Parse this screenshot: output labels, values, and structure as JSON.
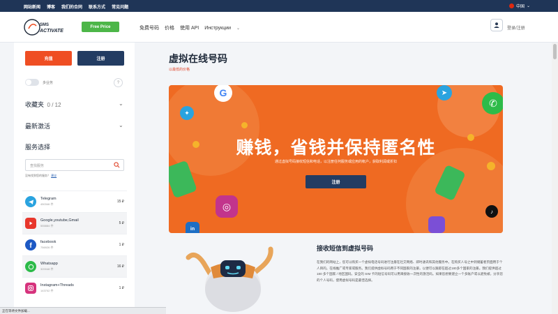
{
  "topbar": {
    "links": [
      "网站新闻",
      "博客",
      "我们的合同",
      "联系方式",
      "常见问题"
    ],
    "language": "中国"
  },
  "header": {
    "logo_text": "SMS ACTIVATE",
    "free_price": "Free Price",
    "nav": [
      "免费号码",
      "价格",
      "使用 API",
      "Инструкции"
    ],
    "login": "登录/注册"
  },
  "sidebar": {
    "btn_recharge": "充值",
    "btn_register": "注册",
    "toggle_label": "多业务",
    "help_icon": "?",
    "favorites": "收藏夹",
    "favorites_count": "0 / 12",
    "recent": "最新激活",
    "services_title": "服务选择",
    "search_placeholder": "查找服务",
    "hint_text": "没有找到您的服务？",
    "hint_link": "建议",
    "services": [
      {
        "name": "Telegram",
        "sub": "450346 件",
        "price": "15 ₽",
        "icon": "telegram-icon",
        "color": "#2aa3df"
      },
      {
        "name": "Google,youtube,Gmail",
        "sub": "555884 件",
        "price": "5 ₽",
        "icon": "google-icon",
        "color": "#e8372c"
      },
      {
        "name": "facebook",
        "sub": "756926 件",
        "price": "1 ₽",
        "icon": "facebook-icon",
        "color": "#1d59c4"
      },
      {
        "name": "Whatsapp",
        "sub": "320048 件",
        "price": "16 ₽",
        "icon": "whatsapp-icon",
        "color": "#2dbb49"
      },
      {
        "name": "Instagram+Threads",
        "sub": "143702 件",
        "price": "1 ₽",
        "icon": "instagram-icon",
        "color": "#d6337d"
      }
    ]
  },
  "main": {
    "title": "虚拟在线号码",
    "subtitle": "以最低的价格",
    "banner_title": "赚钱，省钱并保持匿名性",
    "banner_desc": "通过虚拟号码接收短信和电话，以注册任何服务或应用的帐户，获取利润或折扣",
    "banner_button": "注册",
    "section_title": "接收短信到虚拟号码",
    "section_text": "在我们的网站上，您可以购买一个虚拟电话号码进行注册在社交网络、即时通讯和其他服务中。在购买人号之中到储蓄者页面用于个人目的。在线推广或专家或服务。我们提供虚拟号码用于不同国家的注册，以便可以跟踪在超过180多个国家的注册。我们提供超过 180 多个国家 / 地区国码。安全的 SIM 卡的短信号码可以用来接收一次性的激活码。如果您想要建立一个多账户或以避免被，分享您的个人号码，使用虚拟号码是最佳选择。"
  },
  "status": "正在等待文件加载..."
}
